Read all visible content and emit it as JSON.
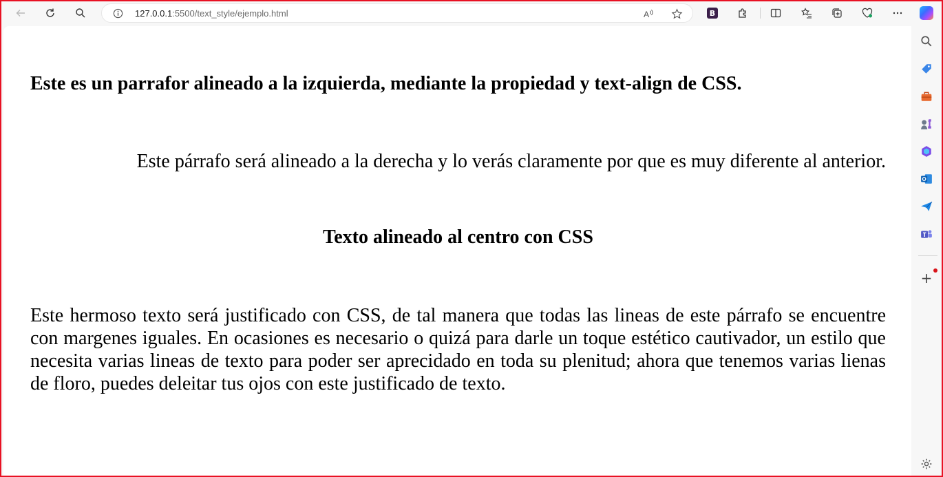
{
  "browser": {
    "url_host": "127.0.0.1",
    "url_rest": ":5500/text_style/ejemplo.html"
  },
  "page": {
    "left_paragraph": "Este es un parrafor alineado a la izquierda, mediante la propiedad y text-align de CSS.",
    "right_paragraph": "Este párrafo será alineado a la derecha y lo verás claramente por que es muy diferente al anterior.",
    "center_heading": "Texto alineado al centro con CSS",
    "justified_paragraph": "Este hermoso texto será justificado con CSS, de tal manera que todas las lineas de este párrafo se encuentre con margenes iguales. En ocasiones es necesario o quizá para darle un toque estético cautivador, un estilo que necesita varias lineas de texto para poder ser aprecidado en toda su plenitud; ahora que tenemos varias lienas de floro, puedes deleitar tus ojos con este justificado de texto."
  },
  "icons": {
    "bing": "B",
    "add": "+"
  },
  "colors": {
    "frame_border": "#e81123",
    "page_background": "#ffffff",
    "chrome_background": "#f7f7f7"
  }
}
